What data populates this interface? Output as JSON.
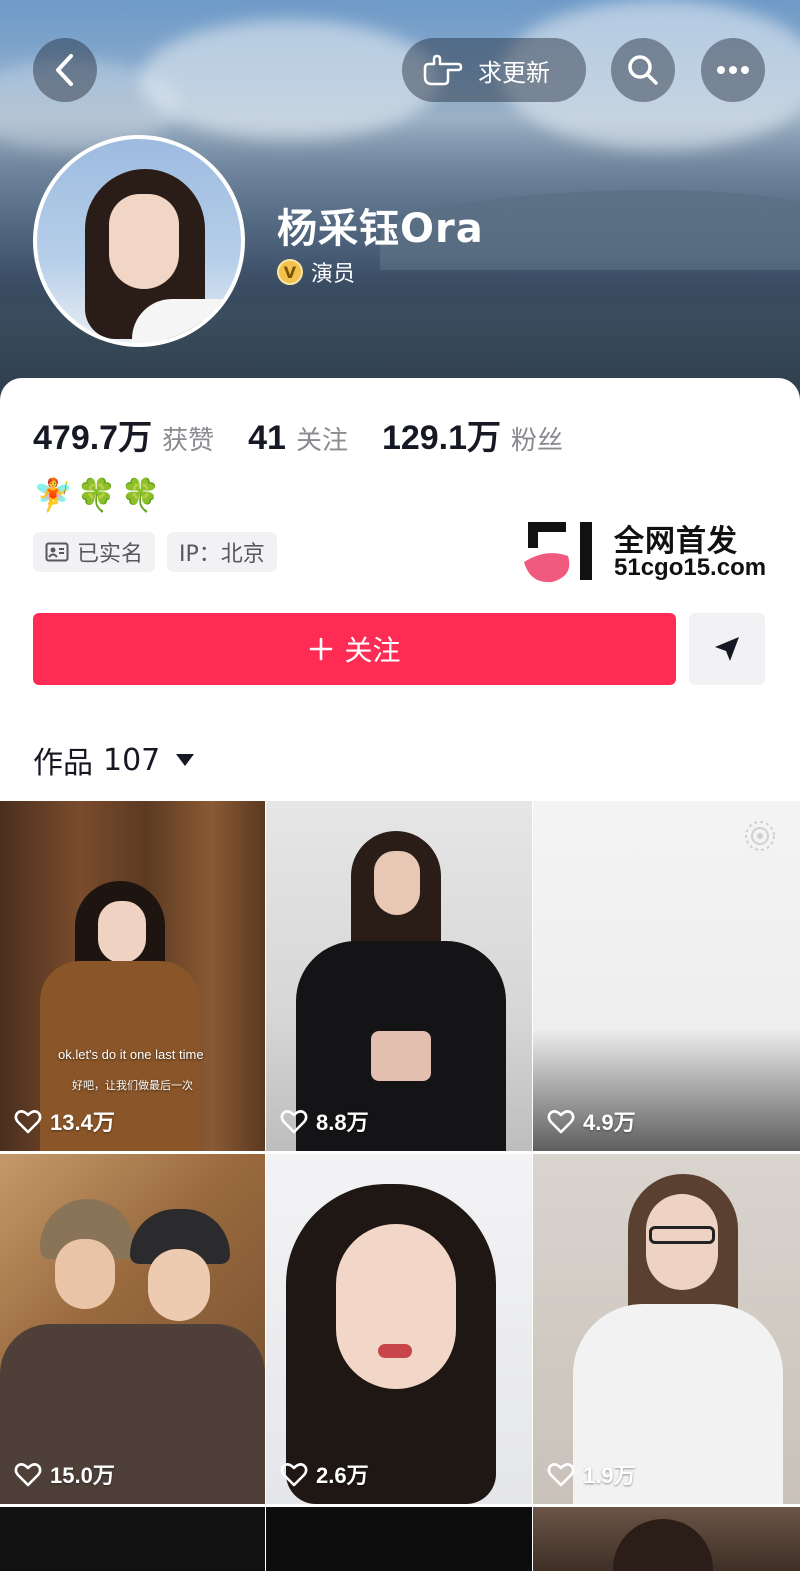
{
  "header": {
    "request_update_label": "求更新",
    "name": "杨采钰Ora",
    "verify_badge": "V",
    "verified_title": "演员"
  },
  "stats": {
    "likes_value": "479.7万",
    "likes_label": "获赞",
    "following_value": "41",
    "following_label": "关注",
    "followers_value": "129.1万",
    "followers_label": "粉丝"
  },
  "bio_emojis": "🧚🍀🍀",
  "tags": {
    "verified_label": "已实名",
    "ip_label": "IP：北京"
  },
  "watermark": {
    "title": "全网首发",
    "url": "51cgo15.com"
  },
  "actions": {
    "follow_label": "关注"
  },
  "works_tab": {
    "label": "作品",
    "count": "107"
  },
  "videos": [
    {
      "likes": "13.4万",
      "caption": "ok.let's do it one last time",
      "subcaption": "好吧，让我们做最后一次"
    },
    {
      "likes": "8.8万"
    },
    {
      "likes": "4.9万"
    },
    {
      "likes": "15.0万"
    },
    {
      "likes": "2.6万"
    },
    {
      "likes": "1.9万"
    }
  ],
  "colors": {
    "accent": "#fe2c55",
    "text_primary": "#161823",
    "text_secondary": "#8a8b91"
  }
}
